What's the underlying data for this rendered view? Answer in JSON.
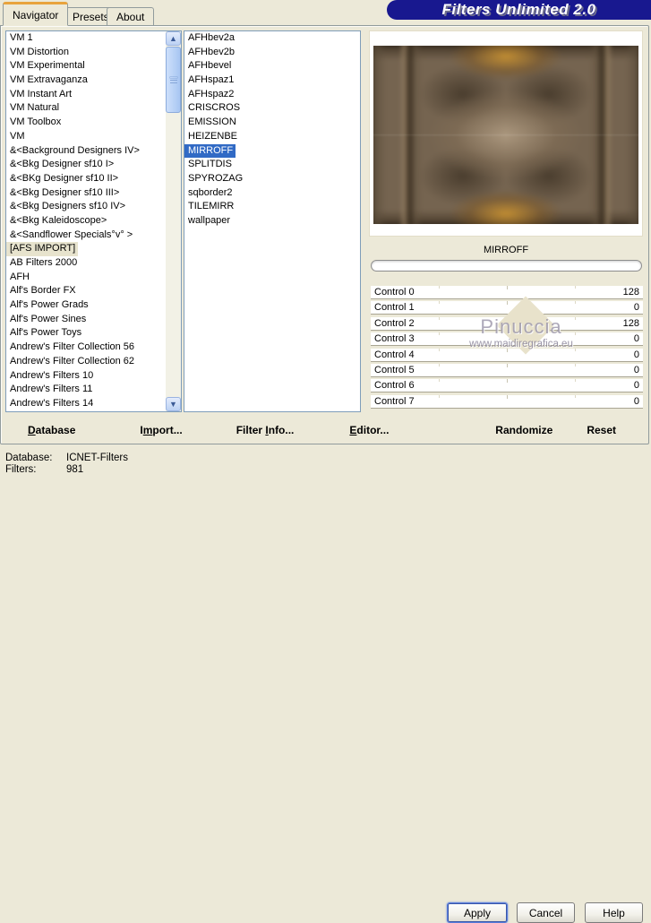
{
  "window": {
    "title": "Filters Unlimited 2.0"
  },
  "tabs": [
    {
      "label": "Navigator",
      "active": true
    },
    {
      "label": "Presets",
      "active": false
    },
    {
      "label": "About",
      "active": false
    }
  ],
  "category_list": {
    "items": [
      {
        "label": "VM 1"
      },
      {
        "label": "VM Distortion"
      },
      {
        "label": "VM Experimental"
      },
      {
        "label": "VM Extravaganza"
      },
      {
        "label": "VM Instant Art"
      },
      {
        "label": "VM Natural"
      },
      {
        "label": "VM Toolbox"
      },
      {
        "label": "VM"
      },
      {
        "label": "&<Background Designers IV>"
      },
      {
        "label": "&<Bkg Designer sf10 I>"
      },
      {
        "label": "&<BKg Designer sf10 II>"
      },
      {
        "label": "&<Bkg Designer sf10 III>"
      },
      {
        "label": "&<Bkg Designers sf10 IV>"
      },
      {
        "label": "&<Bkg Kaleidoscope>"
      },
      {
        "label": "&<Sandflower Specials°v° >"
      },
      {
        "label": "[AFS IMPORT]",
        "selected": "inactive"
      },
      {
        "label": "AB Filters 2000"
      },
      {
        "label": "AFH"
      },
      {
        "label": "Alf's Border FX"
      },
      {
        "label": "Alf's Power Grads"
      },
      {
        "label": "Alf's Power Sines"
      },
      {
        "label": "Alf's Power Toys"
      },
      {
        "label": "Andrew's Filter Collection 56"
      },
      {
        "label": "Andrew's Filter Collection 62"
      },
      {
        "label": "Andrew's Filters 10"
      },
      {
        "label": "Andrew's Filters 11"
      },
      {
        "label": "Andrew's Filters 14"
      }
    ]
  },
  "filter_list": {
    "items": [
      {
        "label": "AFHbev2a"
      },
      {
        "label": "AFHbev2b"
      },
      {
        "label": "AFHbevel"
      },
      {
        "label": "AFHspaz1"
      },
      {
        "label": "AFHspaz2"
      },
      {
        "label": "CRISCROS"
      },
      {
        "label": "EMISSION"
      },
      {
        "label": "HEIZENBE"
      },
      {
        "label": "MIRROFF",
        "selected": "active"
      },
      {
        "label": "SPLITDIS"
      },
      {
        "label": "SPYROZAG"
      },
      {
        "label": "sqborder2"
      },
      {
        "label": "TILEMIRR"
      },
      {
        "label": "wallpaper"
      }
    ]
  },
  "preview": {
    "filter_name": "MIRROFF",
    "progress_percent": 0
  },
  "controls": [
    {
      "label": "Control 0",
      "value": "128"
    },
    {
      "label": "Control 1",
      "value": "0"
    },
    {
      "label": "Control 2",
      "value": "128"
    },
    {
      "label": "Control 3",
      "value": "0"
    },
    {
      "label": "Control 4",
      "value": "0"
    },
    {
      "label": "Control 5",
      "value": "0"
    },
    {
      "label": "Control 6",
      "value": "0"
    },
    {
      "label": "Control 7",
      "value": "0"
    }
  ],
  "watermark": {
    "name": "Pinuccia",
    "url": "www.maidiregrafica.eu"
  },
  "toolbar": {
    "items": [
      {
        "pre": "",
        "key": "D",
        "post": "atabase"
      },
      {
        "pre": "I",
        "key": "m",
        "post": "port..."
      },
      {
        "pre": "Filter ",
        "key": "I",
        "post": "nfo..."
      },
      {
        "pre": "",
        "key": "E",
        "post": "ditor..."
      }
    ],
    "randomize_label": "Randomize",
    "reset_label": "Reset"
  },
  "status": {
    "database_label": "Database:",
    "database_value": "ICNET-Filters",
    "filters_label": "Filters:",
    "filters_value": "981"
  },
  "buttons": {
    "apply": "Apply",
    "cancel": "Cancel",
    "help": "Help"
  },
  "icons": {
    "scroll_up": "▲",
    "scroll_down": "▼"
  },
  "colors": {
    "window_bg": "#ece9d8",
    "banner_navy": "#18188f",
    "tab_accent_orange": "#e8a33d",
    "selection_blue": "#316ac5",
    "inactive_selection": "#e7e3cd",
    "list_border": "#7f9db9"
  }
}
